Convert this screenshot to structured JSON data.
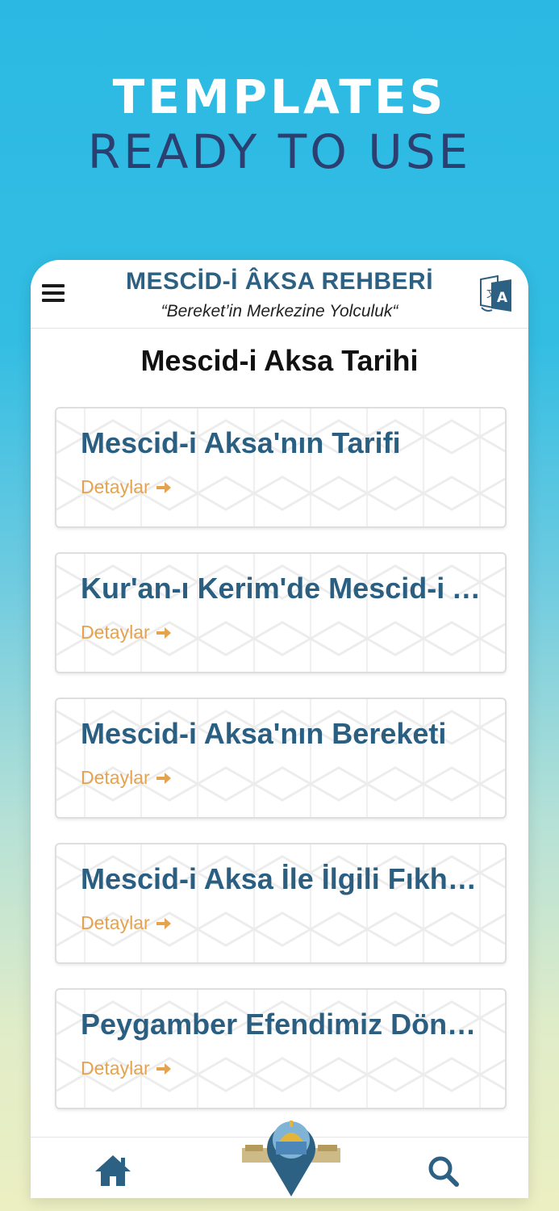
{
  "promo": {
    "line1": "TEMPLATES",
    "line2": "READY TO USE"
  },
  "header": {
    "title": "MESCİD-İ ÂKSA REHBERİ",
    "subtitle": "“Bereket’in Merkezine Yolculuk“",
    "menu_icon": "hamburger-menu-icon",
    "translate_icon": "translate-icon"
  },
  "page": {
    "title": "Mescid-i Aksa Tarihi"
  },
  "cards": [
    {
      "title": "Mescid-i Aksa'nın Tarifi",
      "link": "Detaylar"
    },
    {
      "title": "Kur'an-ı Kerim'de Mescid-i Aksa",
      "link": "Detaylar"
    },
    {
      "title": "Mescid-i Aksa'nın Bereketi",
      "link": "Detaylar"
    },
    {
      "title": "Mescid-i Aksa İle İlgili Fıkhi Hükümler",
      "link": "Detaylar"
    },
    {
      "title": "Peygamber Efendimiz Dönemi",
      "link": "Detaylar"
    }
  ],
  "bottom_nav": {
    "home_icon": "home-icon",
    "center_icon": "dome-of-the-rock-location-pin-icon",
    "search_icon": "search-icon"
  },
  "colors": {
    "title_blue": "#2a5f82",
    "link_orange": "#e5a24f",
    "promo_navy": "#2b3f70",
    "sky": "#2bb9e3"
  }
}
